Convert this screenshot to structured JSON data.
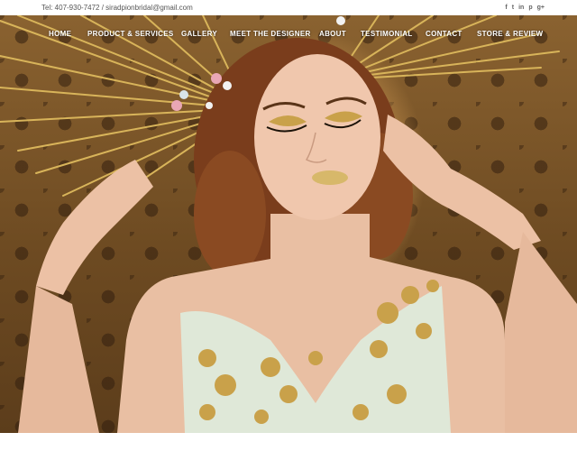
{
  "topbar": {
    "contact": "Tel: 407-930-7472 / siradpionbridal@gmail.com",
    "social": [
      {
        "icon": "facebook-icon",
        "glyph": "f"
      },
      {
        "icon": "twitter-icon",
        "glyph": "t"
      },
      {
        "icon": "linkedin-icon",
        "glyph": "in"
      },
      {
        "icon": "pinterest-icon",
        "glyph": "p"
      },
      {
        "icon": "google-plus-icon",
        "glyph": "g+"
      }
    ]
  },
  "nav": {
    "items": [
      {
        "label": "HOME"
      },
      {
        "label": "PRODUCT & SERVICES"
      },
      {
        "label": "GALLERY"
      },
      {
        "label": "MEET THE DESIGNER"
      },
      {
        "label": "ABOUT"
      },
      {
        "label": "TESTIMONIAL"
      },
      {
        "label": "CONTACT"
      },
      {
        "label": "STORE & REVIEW"
      }
    ]
  },
  "colors": {
    "nav_text": "#ffffff",
    "topbar_text": "#555555",
    "gold": "#c9a14a"
  }
}
